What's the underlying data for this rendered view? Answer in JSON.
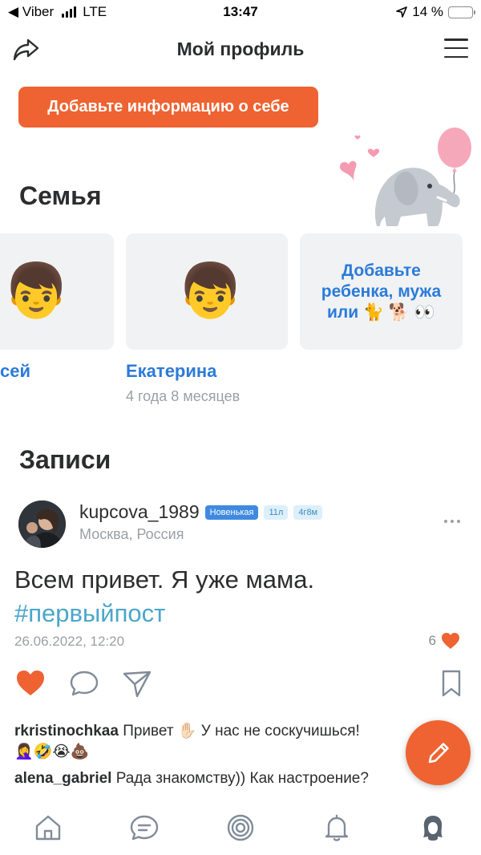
{
  "status": {
    "back_app": "◀ Viber",
    "network": "LTE",
    "time": "13:47",
    "battery": "14 %",
    "battery_level": 0.14
  },
  "header": {
    "title": "Мой профиль"
  },
  "cta": {
    "label": "Добавьте информацию о себе"
  },
  "family": {
    "title": "Семья",
    "members": [
      {
        "name": "сей",
        "age": ""
      },
      {
        "name": "Екатерина",
        "age": "4 года 8 месяцев"
      }
    ],
    "add_label_lines": [
      "Добавьте",
      "ребенка, мужа",
      "или 🐈 🐕 👀"
    ]
  },
  "posts": {
    "title": "Записи",
    "post": {
      "username": "kupcova_1989",
      "badges": [
        "Новенькая",
        "11л",
        "4г8м"
      ],
      "location": "Москва, Россия",
      "text": "Всем привет. Я уже мама.",
      "hashtag": "#первыйпост",
      "date": "26.06.2022, 12:20",
      "likes": "6"
    },
    "comments": [
      {
        "author": "rkristinochkaa",
        "text": "Привет ✋🏻 У нас не соскучишься!",
        "extra": "🤦‍♀️🤣😭💩"
      },
      {
        "author": "alena_gabriel",
        "text": "Рада знакомству)) Как настроение?"
      }
    ]
  },
  "colors": {
    "accent": "#ee6331",
    "link": "#2b7bd8",
    "hashtag": "#4ba6c9"
  },
  "tabbar": {
    "items": [
      "home-icon",
      "chat-icon",
      "target-icon",
      "bell-icon",
      "profile-icon"
    ]
  }
}
